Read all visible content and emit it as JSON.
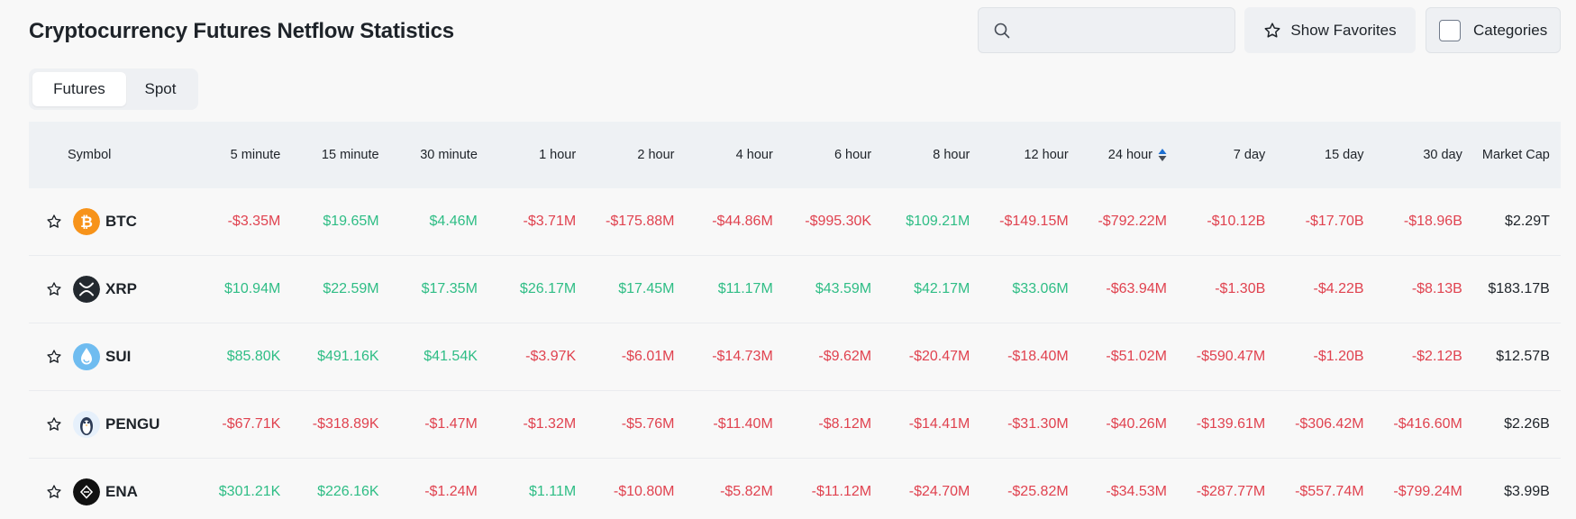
{
  "page": {
    "title": "Cryptocurrency Futures Netflow Statistics"
  },
  "toolbar": {
    "search_placeholder": "",
    "favorites_label": "Show Favorites",
    "categories_label": "Categories"
  },
  "tabs": [
    {
      "label": "Futures",
      "active": true
    },
    {
      "label": "Spot",
      "active": false
    }
  ],
  "table": {
    "columns": [
      "Symbol",
      "5 minute",
      "15 minute",
      "30 minute",
      "1 hour",
      "2 hour",
      "4 hour",
      "6 hour",
      "8 hour",
      "12 hour",
      "24 hour",
      "7 day",
      "15 day",
      "30 day",
      "Market Cap"
    ],
    "sorted_column": "24 hour",
    "rows": [
      {
        "symbol": "BTC",
        "icon": "btc-icon",
        "values": [
          "-$3.35M",
          "$19.65M",
          "$4.46M",
          "-$3.71M",
          "-$175.88M",
          "-$44.86M",
          "-$995.30K",
          "$109.21M",
          "-$149.15M",
          "-$792.22M",
          "-$10.12B",
          "-$17.70B",
          "-$18.96B"
        ],
        "market_cap": "$2.29T"
      },
      {
        "symbol": "XRP",
        "icon": "xrp-icon",
        "values": [
          "$10.94M",
          "$22.59M",
          "$17.35M",
          "$26.17M",
          "$17.45M",
          "$11.17M",
          "$43.59M",
          "$42.17M",
          "$33.06M",
          "-$63.94M",
          "-$1.30B",
          "-$4.22B",
          "-$8.13B"
        ],
        "market_cap": "$183.17B"
      },
      {
        "symbol": "SUI",
        "icon": "sui-icon",
        "values": [
          "$85.80K",
          "$491.16K",
          "$41.54K",
          "-$3.97K",
          "-$6.01M",
          "-$14.73M",
          "-$9.62M",
          "-$20.47M",
          "-$18.40M",
          "-$51.02M",
          "-$590.47M",
          "-$1.20B",
          "-$2.12B"
        ],
        "market_cap": "$12.57B"
      },
      {
        "symbol": "PENGU",
        "icon": "pengu-icon",
        "values": [
          "-$67.71K",
          "-$318.89K",
          "-$1.47M",
          "-$1.32M",
          "-$5.76M",
          "-$11.40M",
          "-$8.12M",
          "-$14.41M",
          "-$31.30M",
          "-$40.26M",
          "-$139.61M",
          "-$306.42M",
          "-$416.60M"
        ],
        "market_cap": "$2.26B"
      },
      {
        "symbol": "ENA",
        "icon": "ena-icon",
        "values": [
          "$301.21K",
          "$226.16K",
          "-$1.24M",
          "$1.11M",
          "-$10.80M",
          "-$5.82M",
          "-$11.12M",
          "-$24.70M",
          "-$25.82M",
          "-$34.53M",
          "-$287.77M",
          "-$557.74M",
          "-$799.24M"
        ],
        "market_cap": "$3.99B"
      }
    ]
  },
  "colors": {
    "positive": "#2ebd85",
    "negative": "#e0424f",
    "header_bg": "#eef1f4",
    "page_bg": "#f8f8f8"
  }
}
